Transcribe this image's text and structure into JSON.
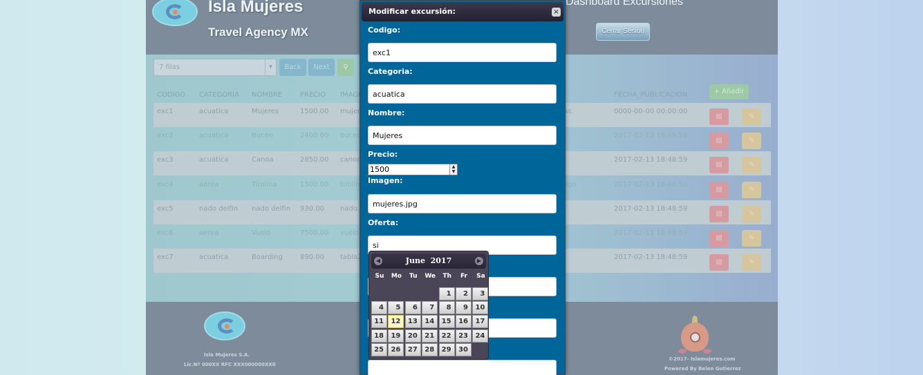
{
  "header": {
    "brand_title": "Isla Mujeres",
    "brand_subtitle": "Travel Agency MX",
    "dashboard_title": "Dashboard Excursiones",
    "logout_label": "Cerrar Sesion"
  },
  "toolbar": {
    "rows_select_value": "7 filas",
    "back_label": "Back",
    "next_label": "Next",
    "add_label": "+ Añadir"
  },
  "table": {
    "headers": [
      "CODIGO",
      "CATEGORIA",
      "NOMBRE",
      "PRECIO",
      "IMAGEN",
      "FECHA_PUBLICACION"
    ],
    "rows": [
      {
        "codigo": "exc1",
        "categoria": "acuatica",
        "nombre": "Mujeres",
        "precio": "1500.00",
        "imagen": "mujere",
        "descripcion": "as.",
        "fecha": "0000-00-00 00:00:00"
      },
      {
        "codigo": "exc2",
        "categoria": "acuatica",
        "nombre": "Buceo",
        "precio": "2400.00",
        "imagen": "buceo",
        "descripcion": "",
        "fecha": "2017-02-13 18:48:59"
      },
      {
        "codigo": "exc3",
        "categoria": "acuatica",
        "nombre": "Canoa",
        "precio": "2850.00",
        "imagen": "canoa",
        "descripcion": "",
        "fecha": "2017-02-13 18:48:59"
      },
      {
        "codigo": "exc4",
        "categoria": "aerea",
        "nombre": "Tirolina",
        "precio": "1500.00",
        "imagen": "tirolina",
        "descripcion": "ago",
        "fecha": "2017-02-13 18:48:59"
      },
      {
        "codigo": "exc5",
        "categoria": "nado delfin",
        "nombre": "nado delfin",
        "precio": "930.00",
        "imagen": "nado.jp",
        "descripcion": "",
        "fecha": "2017-02-13 18:48:59"
      },
      {
        "codigo": "exc6",
        "categoria": "aerea",
        "nombre": "Vuelo",
        "precio": "7500.00",
        "imagen": "vuelo",
        "descripcion": "",
        "fecha": "2017-02-13 18:48:59"
      },
      {
        "codigo": "exc7",
        "categoria": "acuatica",
        "nombre": "Boarding",
        "precio": "890.00",
        "imagen": "tabla2",
        "descripcion": "",
        "fecha": "2017-02-13 18:48:59"
      }
    ]
  },
  "footer": {
    "company": "Isla Mujeres S.A.",
    "license": "Lic.Nº 000XX RFC XXX000000XX0",
    "copyright": "©2017- Islamujeres.com",
    "powered_by": "Powered By Belen Gutierrez"
  },
  "modal": {
    "title": "Modificar excursión:",
    "close_icon": "close-icon",
    "fields": {
      "codigo": {
        "label": "Codigo:",
        "value": "exc1"
      },
      "categoria": {
        "label": "Categoria:",
        "value": "acuatica"
      },
      "nombre": {
        "label": "Nombre:",
        "value": "Mujeres"
      },
      "precio": {
        "label": "Precio:",
        "value": "1500"
      },
      "imagen": {
        "label": "Imagen:",
        "value": "mujeres.jpg"
      },
      "oferta": {
        "label": "Oferta:",
        "value": "si"
      }
    }
  },
  "datepicker": {
    "month": "June",
    "year": "2017",
    "prev_icon": "chevron-left-icon",
    "next_icon": "chevron-right-icon",
    "weekdays": [
      "Su",
      "Mo",
      "Tu",
      "We",
      "Th",
      "Fr",
      "Sa"
    ],
    "leading_blank_days": 4,
    "days": [
      "1",
      "2",
      "3",
      "4",
      "5",
      "6",
      "7",
      "8",
      "9",
      "10",
      "11",
      "12",
      "13",
      "14",
      "15",
      "16",
      "17",
      "18",
      "19",
      "20",
      "21",
      "22",
      "23",
      "24",
      "25",
      "26",
      "27",
      "28",
      "29",
      "30"
    ],
    "today": "12"
  },
  "colors": {
    "modal_bg": "#006599",
    "title_bar": "#2f2a3d",
    "delete_button": "#d9534f",
    "edit_button": "#f0ad4e",
    "add_button": "#5cb85c"
  }
}
